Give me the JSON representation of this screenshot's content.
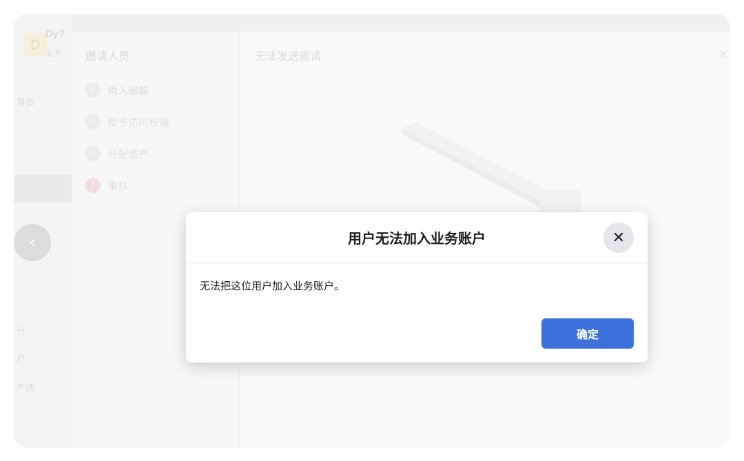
{
  "background": {
    "account": {
      "avatar_letter": "D",
      "name": "Dy7",
      "sub": "业务"
    },
    "rail_items": [
      "首页",
      "分",
      "户",
      "产述"
    ],
    "back_icon": "chevron-left-icon"
  },
  "wizard": {
    "title": "邀请人员",
    "heading": "无法发送邀请",
    "steps": [
      {
        "label": "输入邮箱",
        "status": "done"
      },
      {
        "label": "授予访问权限",
        "status": "done"
      },
      {
        "label": "分配资产",
        "status": "done"
      },
      {
        "label": "审核",
        "status": "error"
      }
    ]
  },
  "modal": {
    "title": "用户无法加入业务账户",
    "message": "无法把这位用户加入业务账户。",
    "ok_label": "确定",
    "close_icon": "close-icon",
    "accent": "#3d72dc"
  }
}
